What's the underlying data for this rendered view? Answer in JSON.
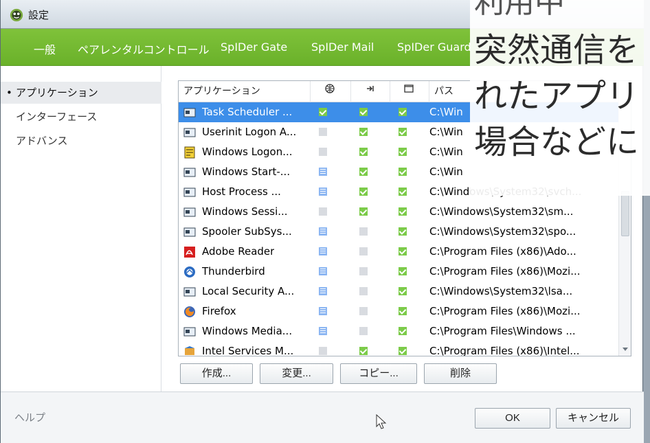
{
  "window": {
    "title": "設定"
  },
  "menu": [
    "一般",
    "ペアレンタルコントロール",
    "SpIDer Gate",
    "SpIDer Mail",
    "SpIDer Guard"
  ],
  "sidebar": {
    "items": [
      {
        "label": "アプリケーション",
        "active": true
      },
      {
        "label": "インターフェース",
        "active": false
      },
      {
        "label": "アドバンス",
        "active": false
      }
    ]
  },
  "table": {
    "headers": [
      "アプリケーション",
      "🌐",
      "⇥",
      "□",
      "パス"
    ],
    "rows": [
      {
        "name": "Task Scheduler ...",
        "net": "on",
        "in": "on",
        "out": "on",
        "path": "C:\\Win",
        "selected": true,
        "icon": "window"
      },
      {
        "name": "Userinit Logon A...",
        "net": "off",
        "in": "on",
        "out": "on",
        "path": "C:\\Win",
        "icon": "window"
      },
      {
        "name": "Windows Logon...",
        "net": "off",
        "in": "on",
        "out": "on",
        "path": "C:\\Win",
        "icon": "logon"
      },
      {
        "name": "Windows Start-...",
        "net": "list",
        "in": "on",
        "out": "on",
        "path": "C:\\Win",
        "icon": "window"
      },
      {
        "name": "Host Process ...",
        "net": "list",
        "in": "on",
        "out": "on",
        "path": "C:\\Windows\\System32\\svch...",
        "icon": "window"
      },
      {
        "name": "Windows Sessi...",
        "net": "off",
        "in": "on",
        "out": "on",
        "path": "C:\\Windows\\System32\\sm...",
        "icon": "window"
      },
      {
        "name": "Spooler SubSys...",
        "net": "list",
        "in": "off",
        "out": "on",
        "path": "C:\\Windows\\System32\\spo...",
        "icon": "window"
      },
      {
        "name": "Adobe Reader",
        "net": "list",
        "in": "off",
        "out": "on",
        "path": "C:\\Program Files (x86)\\Ado...",
        "icon": "adobe"
      },
      {
        "name": "Thunderbird",
        "net": "list",
        "in": "off",
        "out": "on",
        "path": "C:\\Program Files (x86)\\Mozi...",
        "icon": "thunderbird"
      },
      {
        "name": "Local Security A...",
        "net": "list",
        "in": "off",
        "out": "on",
        "path": "C:\\Windows\\System32\\lsa...",
        "icon": "window"
      },
      {
        "name": "Firefox",
        "net": "list",
        "in": "off",
        "out": "on",
        "path": "C:\\Program Files (x86)\\Mozi...",
        "icon": "firefox"
      },
      {
        "name": "Windows Media...",
        "net": "list",
        "in": "off",
        "out": "on",
        "path": "C:\\Program Files\\Windows ...",
        "icon": "window"
      },
      {
        "name": "Intel Services M...",
        "net": "off",
        "in": "on",
        "out": "on",
        "path": "C:\\Program Files (x86)\\Intel...",
        "icon": "intel"
      }
    ]
  },
  "actions": {
    "create": "作成...",
    "change": "変更...",
    "copy": "コピー...",
    "delete": "削除"
  },
  "footer": {
    "help": "ヘルプ",
    "ok": "OK",
    "cancel": "キャンセル"
  },
  "overlay": {
    "line0": "利用中",
    "line1": "突然通信を",
    "line2": "れたアプリ",
    "line3": "場合などに"
  },
  "colors": {
    "green": "#72b930",
    "selected_row": "#3d8ee9"
  }
}
